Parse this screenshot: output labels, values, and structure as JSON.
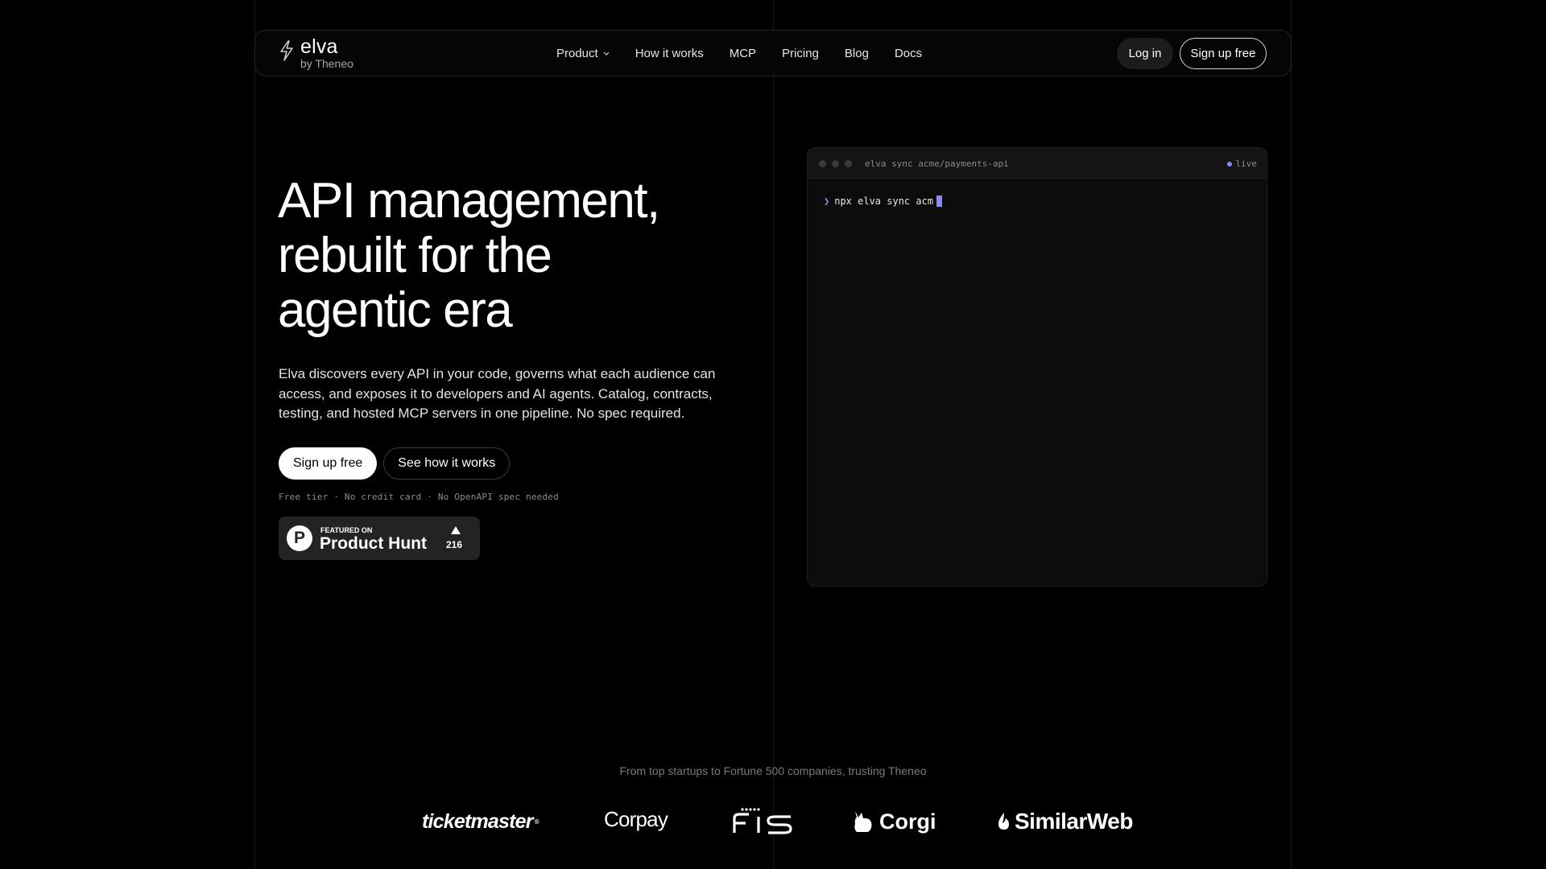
{
  "nav": {
    "logo_name": "elva",
    "logo_sub": "by Theneo",
    "links": [
      "Product",
      "How it works",
      "MCP",
      "Pricing",
      "Blog",
      "Docs"
    ],
    "login": "Log in",
    "signup": "Sign up free"
  },
  "hero": {
    "title_lines": [
      "API management,",
      "rebuilt for the",
      "agentic era"
    ],
    "description": "Elva discovers every API in your code, governs what each audience can access, and exposes it to developers and AI agents. Catalog, contracts, testing, and hosted MCP servers in one pipeline. No spec required.",
    "primary_cta": "Sign up free",
    "secondary_cta": "See how it works",
    "fine_print": "Free tier · No credit card · No OpenAPI spec needed"
  },
  "product_hunt": {
    "featured": "FEATURED ON",
    "name": "Product Hunt",
    "letter": "P",
    "votes": "216"
  },
  "terminal": {
    "title": "elva sync acme/payments-api",
    "status": "live",
    "prompt": "❯",
    "command": "npx elva sync acm"
  },
  "trust": {
    "text": "From top startups to Fortune 500 companies, trusting Theneo",
    "logos": [
      "ticketmaster",
      "Corpay",
      "FIS",
      "Corgi",
      "SimilarWeb"
    ]
  },
  "colors": {
    "background": "#000000",
    "accent": "#8b87ff",
    "terminal_bg": "#0c0c0c"
  }
}
